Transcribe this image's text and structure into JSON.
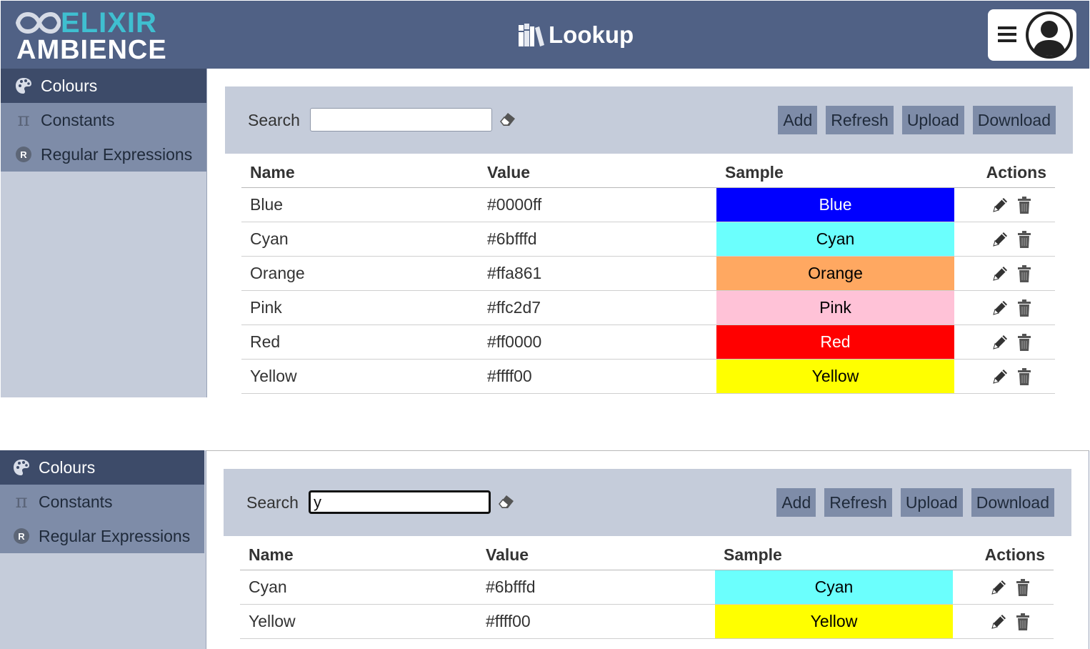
{
  "header": {
    "logo_line1": "ELIXIR",
    "logo_line2": "AMBIENCE",
    "title": "Lookup"
  },
  "sidebar": {
    "items": [
      {
        "label": "Colours",
        "icon": "palette-icon",
        "active": true
      },
      {
        "label": "Constants",
        "icon": "pi-icon",
        "active": false
      },
      {
        "label": "Regular Expressions",
        "icon": "regex-icon",
        "active": false
      }
    ],
    "regex_badge": "R",
    "pi_glyph": "π"
  },
  "toolbar": {
    "search_label": "Search",
    "add_label": "Add",
    "refresh_label": "Refresh",
    "upload_label": "Upload",
    "download_label": "Download"
  },
  "table": {
    "headers": {
      "name": "Name",
      "value": "Value",
      "sample": "Sample",
      "actions": "Actions"
    }
  },
  "views": [
    {
      "search_value": "",
      "rows": [
        {
          "name": "Blue",
          "value": "#0000ff",
          "sample": "Blue",
          "bg": "#0000ff",
          "fg": "#ffffff"
        },
        {
          "name": "Cyan",
          "value": "#6bfffd",
          "sample": "Cyan",
          "bg": "#6bfffd",
          "fg": "#000000"
        },
        {
          "name": "Orange",
          "value": "#ffa861",
          "sample": "Orange",
          "bg": "#ffa861",
          "fg": "#000000"
        },
        {
          "name": "Pink",
          "value": "#ffc2d7",
          "sample": "Pink",
          "bg": "#ffc2d7",
          "fg": "#000000"
        },
        {
          "name": "Red",
          "value": "#ff0000",
          "sample": "Red",
          "bg": "#ff0000",
          "fg": "#ffffff"
        },
        {
          "name": "Yellow",
          "value": "#ffff00",
          "sample": "Yellow",
          "bg": "#ffff00",
          "fg": "#000000"
        }
      ]
    },
    {
      "search_value": "y",
      "rows": [
        {
          "name": "Cyan",
          "value": "#6bfffd",
          "sample": "Cyan",
          "bg": "#6bfffd",
          "fg": "#000000"
        },
        {
          "name": "Yellow",
          "value": "#ffff00",
          "sample": "Yellow",
          "bg": "#ffff00",
          "fg": "#000000"
        }
      ]
    }
  ]
}
